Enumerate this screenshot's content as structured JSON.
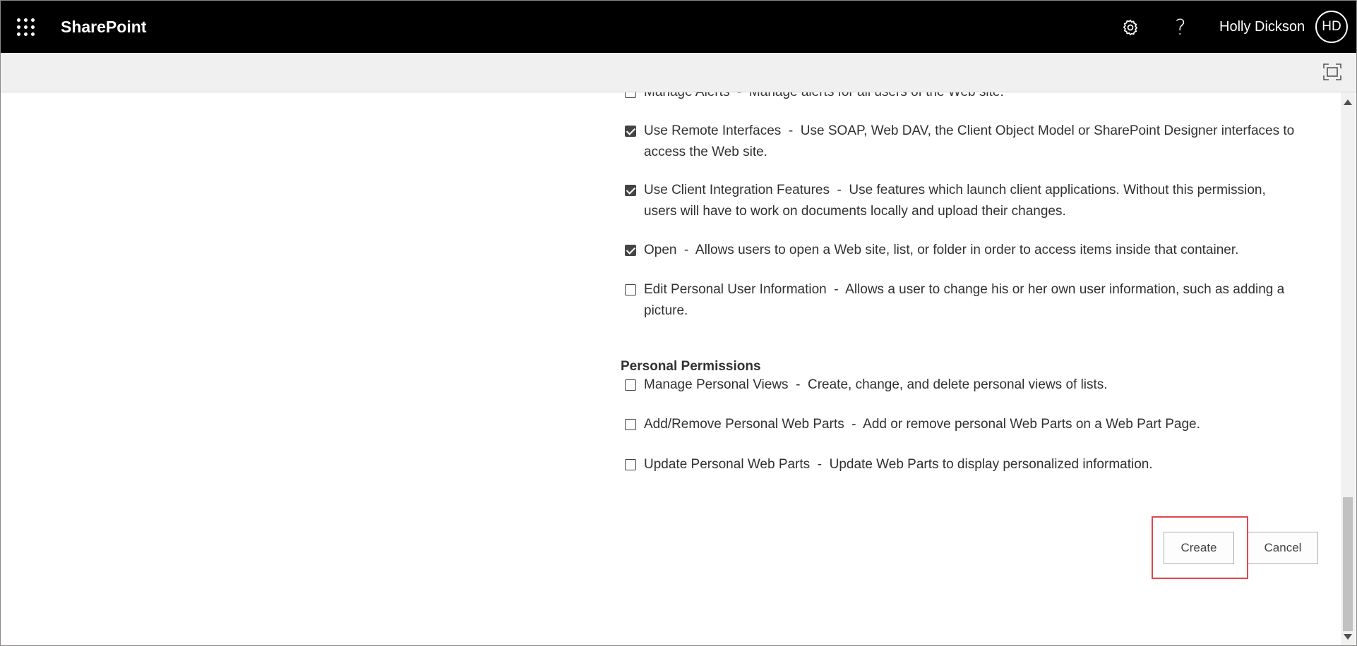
{
  "suitebar": {
    "app_name": "SharePoint",
    "user_name": "Holly Dickson",
    "user_initials": "HD",
    "icons": [
      "app-launcher-icon",
      "settings-gear-icon",
      "help-icon"
    ]
  },
  "permissions": [
    {
      "name": "Manage Alerts",
      "description": "Manage alerts for all users of the Web site.",
      "checked": false
    },
    {
      "name": "Use Remote Interfaces",
      "description": "Use SOAP, Web DAV, the Client Object Model or SharePoint Designer interfaces to",
      "description_cont": "access the Web site.",
      "checked": true
    },
    {
      "name": "Use Client Integration Features",
      "description": "Use features which launch client applications. Without this permission,",
      "description_cont": "users will have to work on documents locally and upload their changes.",
      "checked": true
    },
    {
      "name": "Open",
      "description": "Allows users to open a Web site, list, or folder in order to access items inside that container.",
      "checked": true
    },
    {
      "name": "Edit Personal User Information",
      "description": "Allows a user to change his or her own user information, such as adding a",
      "description_cont": "picture.",
      "checked": false
    }
  ],
  "personal_group": {
    "title": "Personal Permissions",
    "items": [
      {
        "name": "Manage Personal Views",
        "description": "Create, change, and delete personal views of lists.",
        "checked": false
      },
      {
        "name": "Add/Remove Personal Web Parts",
        "description": "Add or remove personal Web Parts on a Web Part Page.",
        "checked": false
      },
      {
        "name": "Update Personal Web Parts",
        "description": "Update Web Parts to display personalized information.",
        "checked": false
      }
    ]
  },
  "separator": "  -  ",
  "buttons": {
    "create": "Create",
    "cancel": "Cancel"
  },
  "colors": {
    "suitebar_bg": "#000000",
    "highlight": "#e0474c"
  }
}
